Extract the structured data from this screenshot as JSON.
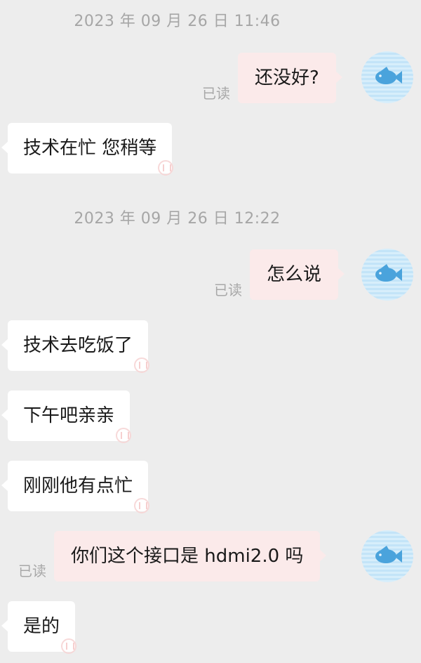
{
  "messages": [
    {
      "kind": "timestamp",
      "text": "2023 年 09 月 26 日 11:46"
    },
    {
      "kind": "outgoing",
      "text": "还没好?",
      "status": "已读"
    },
    {
      "kind": "incoming",
      "text": "技术在忙 您稍等"
    },
    {
      "kind": "timestamp",
      "text": "2023 年 09 月 26 日 12:22"
    },
    {
      "kind": "outgoing",
      "text": "怎么说",
      "status": "已读"
    },
    {
      "kind": "incoming",
      "text": "技术去吃饭了"
    },
    {
      "kind": "incoming",
      "text": "下午吧亲亲"
    },
    {
      "kind": "incoming",
      "text": "刚刚他有点忙"
    },
    {
      "kind": "outgoing",
      "text": "你们这个接口是 hdmi2.0 吗",
      "status": "已读"
    },
    {
      "kind": "incoming",
      "text": "是的"
    }
  ],
  "avatar": {
    "icon": "fish-icon",
    "fish_color": "#4aa3dc",
    "background": "#d3ebfa"
  },
  "colors": {
    "background": "#ededed",
    "outgoing_bubble": "#fbeaea",
    "incoming_bubble": "#ffffff",
    "meta_text": "#a6a6a6"
  }
}
